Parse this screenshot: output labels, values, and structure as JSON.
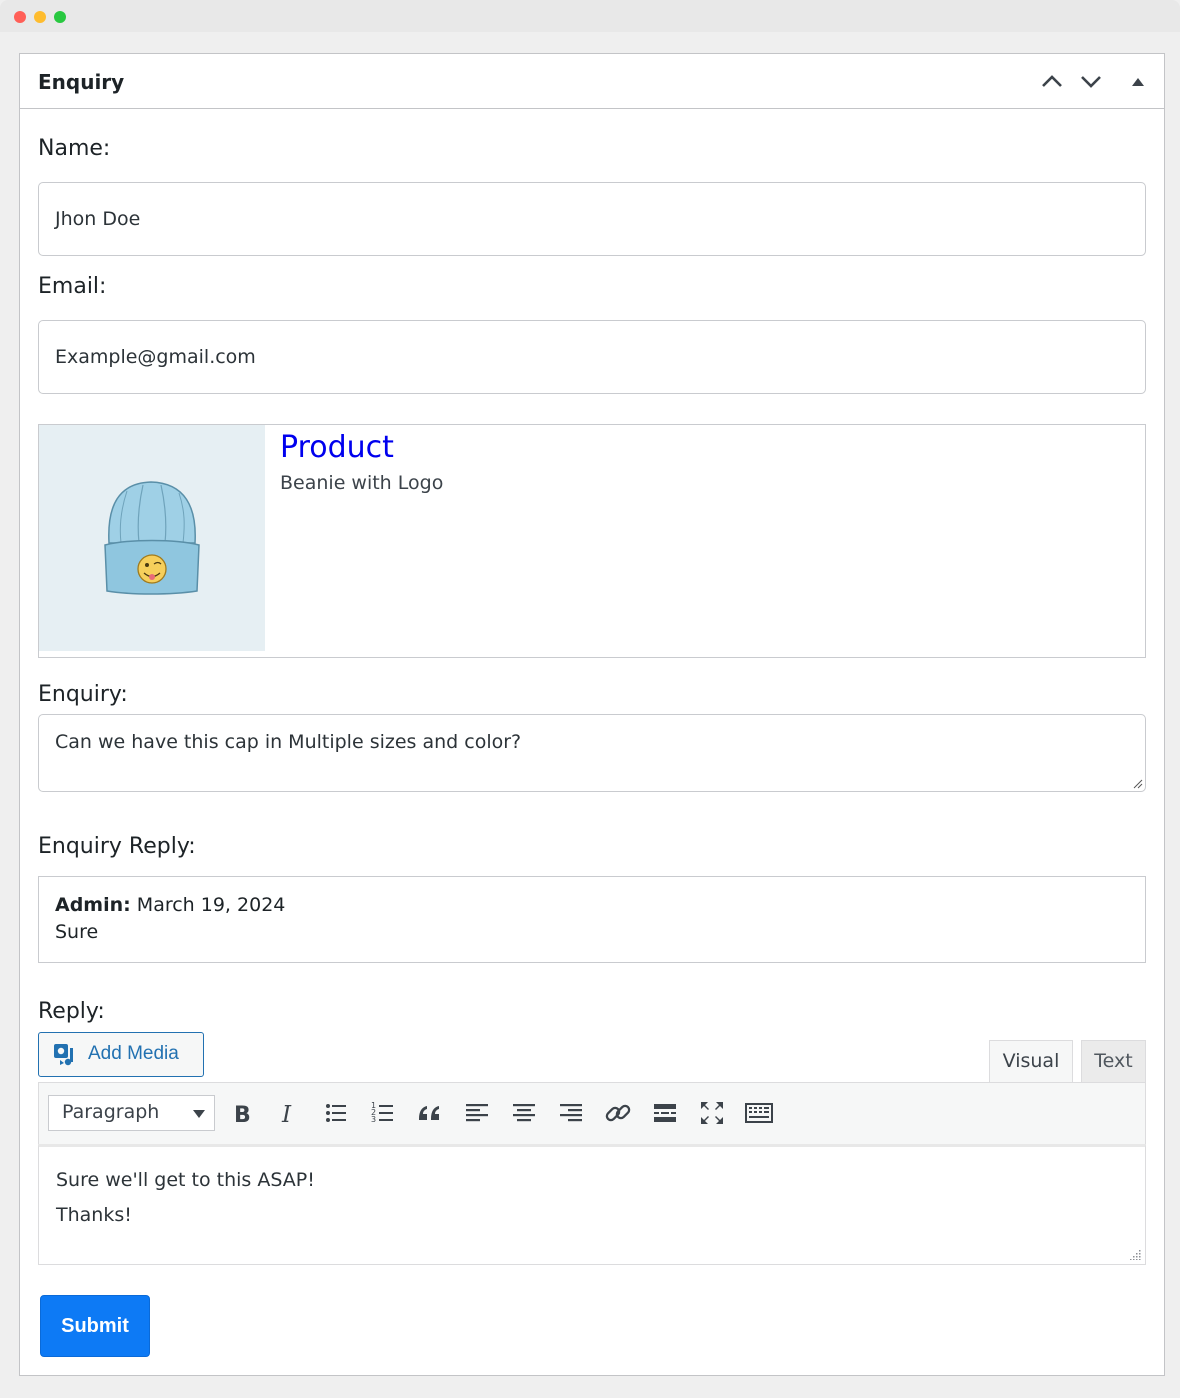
{
  "window": {
    "controls": [
      "close",
      "minimize",
      "maximize"
    ]
  },
  "panel": {
    "title": "Enquiry",
    "controls": [
      "chevron-up-icon",
      "chevron-down-icon",
      "triangle-up-icon"
    ]
  },
  "form": {
    "name_label": "Name:",
    "name_value": "Jhon Doe",
    "email_label": "Email:",
    "email_value": "Example@gmail.com",
    "product": {
      "heading": "Product",
      "name": "Beanie with Logo",
      "image": "beanie-image"
    },
    "enquiry_label": "Enquiry:",
    "enquiry_text": "Can we have this cap in Multiple sizes and color?",
    "enquiry_reply_label": "Enquiry Reply:",
    "reply": {
      "author": "Admin:",
      "date": "March 19, 2024",
      "message": "Sure"
    },
    "reply_label": "Reply:",
    "add_media_label": "Add Media",
    "tabs": {
      "visual": "Visual",
      "text": "Text",
      "active": "visual"
    },
    "format_select": "Paragraph",
    "toolbar_icons": [
      "bold-icon",
      "italic-icon",
      "bulleted-list-icon",
      "numbered-list-icon",
      "blockquote-icon",
      "align-left-icon",
      "align-center-icon",
      "align-right-icon",
      "link-icon",
      "read-more-icon",
      "fullscreen-icon",
      "toolbar-toggle-icon"
    ],
    "editor_lines": [
      "Sure we'll get to this ASAP!",
      "Thanks!"
    ],
    "submit_label": "Submit"
  },
  "colors": {
    "accent": "#0d7af5",
    "link": "#0000ee",
    "wp_blue": "#2271b1"
  }
}
